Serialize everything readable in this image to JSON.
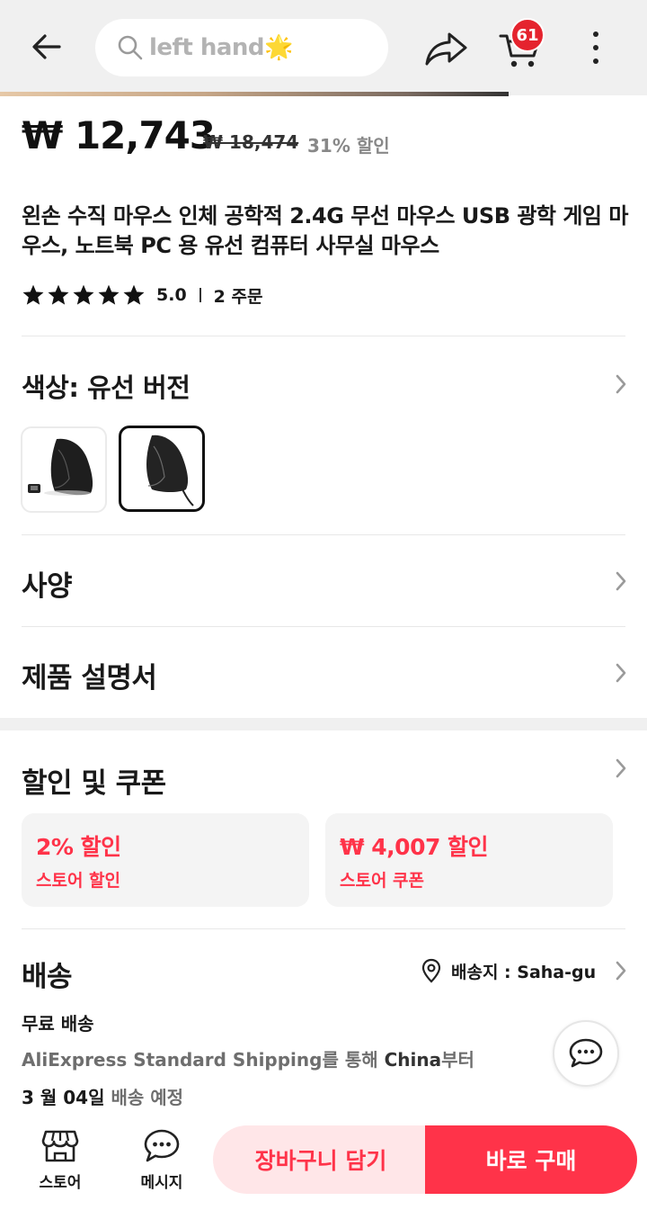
{
  "header": {
    "search_query": "left hand🌟",
    "cart_count": "61"
  },
  "product": {
    "price": "₩ 12,743",
    "original_price": "₩ 18,474",
    "discount": "31% 할인",
    "title": "왼손 수직 마우스 인체 공학적 2.4G 무선 마우스 USB 광학 게임 마우스, 노트북 PC 용 유선 컴퓨터 사무실 마우스",
    "rating": "5.0",
    "stars": 5,
    "orders": "2 주문"
  },
  "color": {
    "label": "색상: 유선 버전",
    "selected_index": 1
  },
  "sections": {
    "specs": "사양",
    "manual": "제품 설명서",
    "coupons": "할인 및 쿠폰",
    "shipping": "배송"
  },
  "coupons": [
    {
      "amount": "2% 할인",
      "label": "스토어 할인"
    },
    {
      "amount": "₩ 4,007 할인",
      "label": "스토어 쿠폰"
    }
  ],
  "shipping": {
    "destination": "배송지 : Saha-gu",
    "free": "무료 배송",
    "via_service": "AliExpress Standard Shipping",
    "via_mid": "를 통해 ",
    "via_origin": "China",
    "via_end": "부터",
    "eta_date": "3 월 04일",
    "eta_suffix": " 배송 예정"
  },
  "bottom_bar": {
    "store": "스토어",
    "message": "메시지",
    "add_to_cart": "장바구니 담기",
    "buy_now": "바로 구매"
  },
  "colors": {
    "accent": "#ff3349",
    "badge": "#e5232e",
    "cart_button_bg": "#ffe6e8"
  }
}
